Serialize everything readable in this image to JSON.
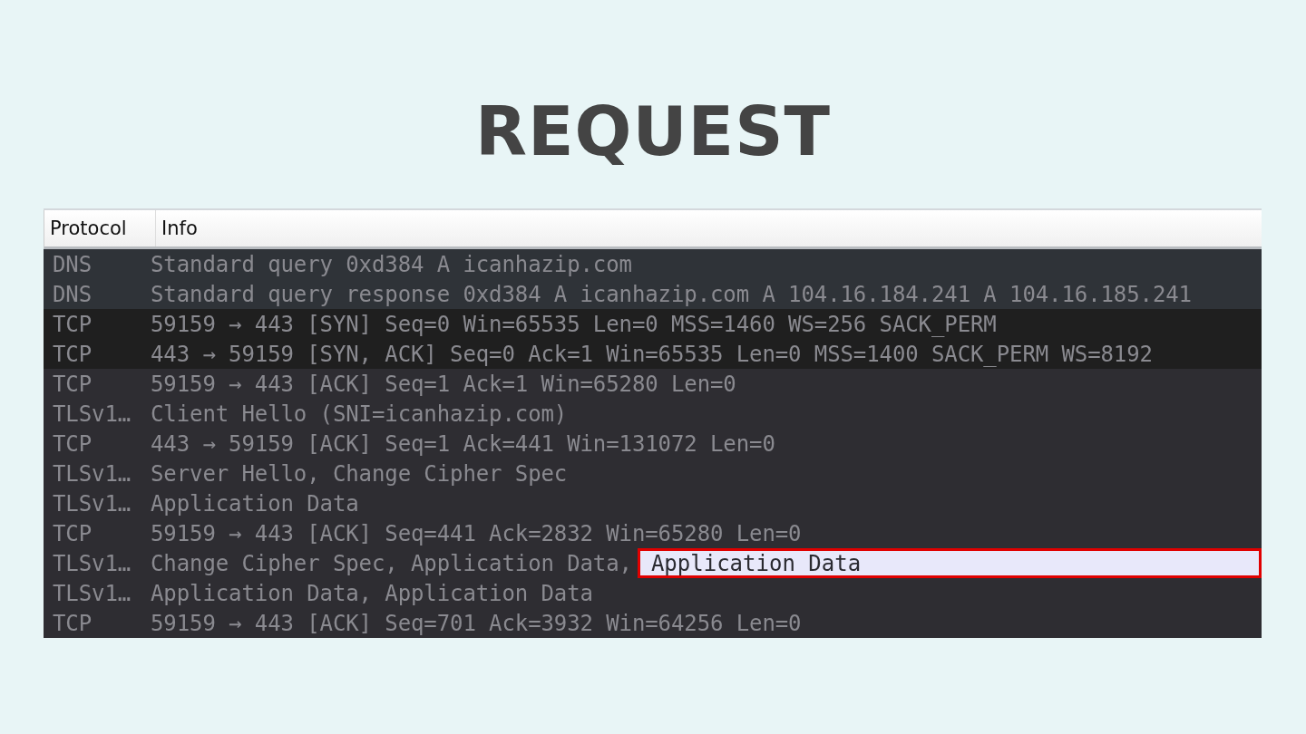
{
  "title": "REQUEST",
  "table": {
    "columns": [
      "Protocol",
      "Info"
    ],
    "rows": [
      {
        "protocol": "DNS",
        "info": "Standard query 0xd384 A icanhazip.com",
        "color": "#2f3338"
      },
      {
        "protocol": "DNS",
        "info": "Standard query response 0xd384 A icanhazip.com A 104.16.184.241 A 104.16.185.241",
        "color": "#2f3338"
      },
      {
        "protocol": "TCP",
        "info": "59159 → 443 [SYN] Seq=0 Win=65535 Len=0 MSS=1460 WS=256 SACK_PERM",
        "color": "#1f1f1f"
      },
      {
        "protocol": "TCP",
        "info": "443 → 59159 [SYN, ACK] Seq=0 Ack=1 Win=65535 Len=0 MSS=1400 SACK_PERM WS=8192",
        "color": "#1f1f1f"
      },
      {
        "protocol": "TCP",
        "info": "59159 → 443 [ACK] Seq=1 Ack=1 Win=65280 Len=0",
        "color": "#2e2d32"
      },
      {
        "protocol": "TLSv1…",
        "info": "Client Hello (SNI=icanhazip.com)",
        "color": "#2e2d32"
      },
      {
        "protocol": "TCP",
        "info": "443 → 59159 [ACK] Seq=1 Ack=441 Win=131072 Len=0",
        "color": "#2e2d32"
      },
      {
        "protocol": "TLSv1…",
        "info": "Server Hello, Change Cipher Spec",
        "color": "#2e2d32"
      },
      {
        "protocol": "TLSv1…",
        "info": "Application Data",
        "color": "#2e2d32"
      },
      {
        "protocol": "TCP",
        "info": "59159 → 443 [ACK] Seq=441 Ack=2832 Win=65280 Len=0",
        "color": "#2e2d32"
      },
      {
        "protocol": "TLSv1…",
        "info": "Change Cipher Spec, Application Data,",
        "highlight": "Application Data",
        "color": "#2e2d32"
      },
      {
        "protocol": "TLSv1…",
        "info": "Application Data, Application Data",
        "color": "#2e2d32"
      },
      {
        "protocol": "TCP",
        "info": "59159 → 443 [ACK] Seq=701 Ack=3932 Win=64256 Len=0",
        "color": "#2e2d32"
      }
    ]
  }
}
